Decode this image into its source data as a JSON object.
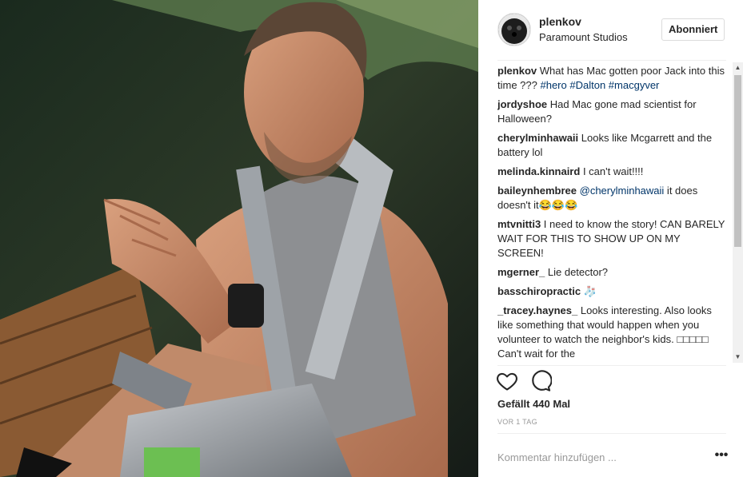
{
  "post": {
    "username": "plenkov",
    "location": "Paramount Studios",
    "follow_label": "Abonniert",
    "likes_label": "Gefällt 440 Mal",
    "timestamp": "VOR 1 TAG",
    "comment_placeholder": "Kommentar hinzufügen ...",
    "more_label": "•••"
  },
  "comments": [
    {
      "user": "plenkov",
      "parts": [
        {
          "t": "text",
          "v": "What has Mac gotten poor Jack into this time ??? "
        },
        {
          "t": "tag",
          "v": "#hero"
        },
        {
          "t": "text",
          "v": " "
        },
        {
          "t": "tag",
          "v": "#Dalton"
        },
        {
          "t": "text",
          "v": " "
        },
        {
          "t": "tag",
          "v": "#macgyver"
        }
      ]
    },
    {
      "user": "jordyshoe",
      "parts": [
        {
          "t": "text",
          "v": "Had Mac gone mad scientist for Halloween?"
        }
      ]
    },
    {
      "user": "cherylminhawaii",
      "parts": [
        {
          "t": "text",
          "v": "Looks like Mcgarrett and the battery lol"
        }
      ]
    },
    {
      "user": "melinda.kinnaird",
      "parts": [
        {
          "t": "text",
          "v": "I can't wait!!!!"
        }
      ]
    },
    {
      "user": "baileynhembree",
      "parts": [
        {
          "t": "tag",
          "v": "@cherylminhawaii"
        },
        {
          "t": "text",
          "v": " it does doesn't it😂😂😂"
        }
      ]
    },
    {
      "user": "mtvnitti3",
      "parts": [
        {
          "t": "text",
          "v": "I need to know the story! CAN BARELY WAIT FOR THIS TO SHOW UP ON MY SCREEN!"
        }
      ]
    },
    {
      "user": "mgerner_",
      "parts": [
        {
          "t": "text",
          "v": "Lie detector?"
        }
      ]
    },
    {
      "user": "basschiropractic",
      "parts": [
        {
          "t": "text",
          "v": "🧦"
        }
      ]
    },
    {
      "user": "_tracey.haynes_",
      "parts": [
        {
          "t": "text",
          "v": "Looks interesting. Also looks like something that would happen when you volunteer to watch the neighbor's kids. □□□□□ Can't wait for the"
        }
      ]
    }
  ],
  "icons": {
    "like": "heart-icon",
    "comment": "comment-bubble-icon",
    "more": "more-options-icon"
  },
  "colors": {
    "text": "#262626",
    "hashtag": "#003569",
    "muted": "#999999",
    "border": "#dbdbdb"
  }
}
